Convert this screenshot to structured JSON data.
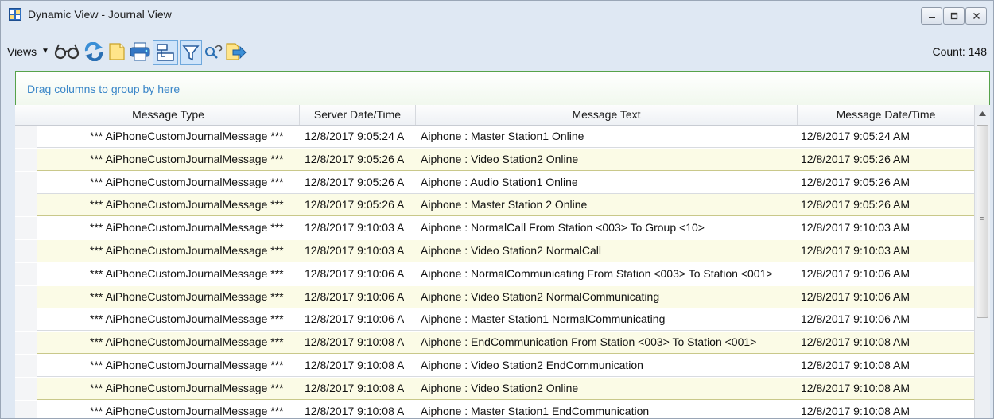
{
  "window": {
    "title": "Dynamic View  -  Journal View"
  },
  "toolbar": {
    "views_label": "Views",
    "icons": [
      "glasses-icon",
      "refresh-icon",
      "new-document-icon",
      "print-icon",
      "layout-icon",
      "filter-icon",
      "find-icon",
      "export-icon"
    ],
    "count_label": "Count:",
    "count_value": "148"
  },
  "group_panel": {
    "hint": "Drag columns to group by here"
  },
  "grid": {
    "columns": [
      "Message Type",
      "Server Date/Time",
      "Message Text",
      "Message Date/Time"
    ],
    "rows": [
      {
        "type": "*** AiPhoneCustomJournalMessage ***",
        "server": "12/8/2017 9:05:24 A",
        "text": "Aiphone : Master Station1 Online",
        "date": "12/8/2017 9:05:24 AM"
      },
      {
        "type": "*** AiPhoneCustomJournalMessage ***",
        "server": "12/8/2017 9:05:26 A",
        "text": "Aiphone : Video Station2 Online",
        "date": "12/8/2017 9:05:26 AM"
      },
      {
        "type": "*** AiPhoneCustomJournalMessage ***",
        "server": "12/8/2017 9:05:26 A",
        "text": "Aiphone : Audio Station1 Online",
        "date": "12/8/2017 9:05:26 AM"
      },
      {
        "type": "*** AiPhoneCustomJournalMessage ***",
        "server": "12/8/2017 9:05:26 A",
        "text": "Aiphone : Master Station 2 Online",
        "date": "12/8/2017 9:05:26 AM"
      },
      {
        "type": "*** AiPhoneCustomJournalMessage ***",
        "server": "12/8/2017 9:10:03 A",
        "text": "Aiphone : NormalCall From Station <003> To Group <10>",
        "date": "12/8/2017 9:10:03 AM"
      },
      {
        "type": "*** AiPhoneCustomJournalMessage ***",
        "server": "12/8/2017 9:10:03 A",
        "text": "Aiphone : Video Station2 NormalCall",
        "date": "12/8/2017 9:10:03 AM"
      },
      {
        "type": "*** AiPhoneCustomJournalMessage ***",
        "server": "12/8/2017 9:10:06 A",
        "text": "Aiphone : NormalCommunicating From Station <003> To Station <001>",
        "date": "12/8/2017 9:10:06 AM"
      },
      {
        "type": "*** AiPhoneCustomJournalMessage ***",
        "server": "12/8/2017 9:10:06 A",
        "text": "Aiphone : Video Station2 NormalCommunicating",
        "date": "12/8/2017 9:10:06 AM"
      },
      {
        "type": "*** AiPhoneCustomJournalMessage ***",
        "server": "12/8/2017 9:10:06 A",
        "text": "Aiphone : Master Station1 NormalCommunicating",
        "date": "12/8/2017 9:10:06 AM"
      },
      {
        "type": "*** AiPhoneCustomJournalMessage ***",
        "server": "12/8/2017 9:10:08 A",
        "text": "Aiphone : EndCommunication From Station <003> To Station <001>",
        "date": "12/8/2017 9:10:08 AM"
      },
      {
        "type": "*** AiPhoneCustomJournalMessage ***",
        "server": "12/8/2017 9:10:08 A",
        "text": "Aiphone : Video Station2 EndCommunication",
        "date": "12/8/2017 9:10:08 AM"
      },
      {
        "type": "*** AiPhoneCustomJournalMessage ***",
        "server": "12/8/2017 9:10:08 A",
        "text": "Aiphone : Video Station2 Online",
        "date": "12/8/2017 9:10:08 AM"
      },
      {
        "type": "*** AiPhoneCustomJournalMessage ***",
        "server": "12/8/2017 9:10:08 A",
        "text": "Aiphone : Master Station1 EndCommunication",
        "date": "12/8/2017 9:10:08 AM"
      }
    ]
  },
  "colors": {
    "alt_row": "#fbfbe6",
    "group_border": "#56a24a",
    "group_hint": "#3a86c8"
  }
}
